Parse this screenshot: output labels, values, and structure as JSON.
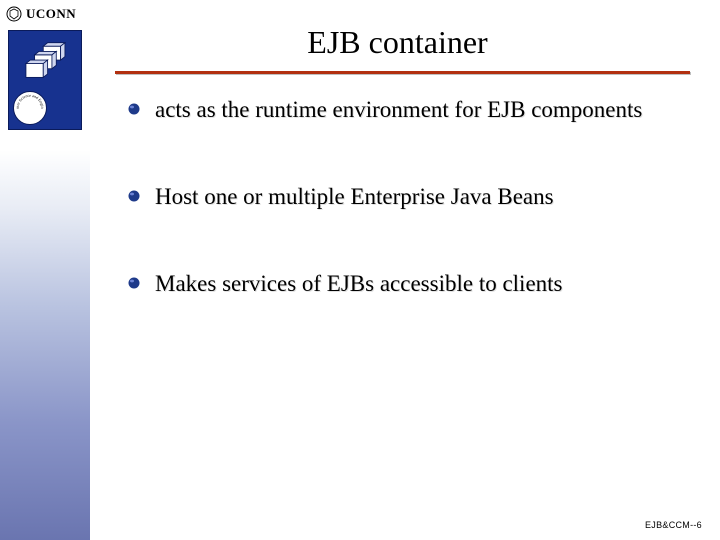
{
  "brand": {
    "uconn_label": "UCONN",
    "dept_circle_text": "Computer Science and Engineering"
  },
  "slide": {
    "title": "EJB container",
    "bullets": [
      "acts as the runtime environment for EJB components",
      "Host one or multiple Enterprise Java Beans",
      "Makes services of EJBs accessible to clients"
    ],
    "footer": "EJB&CCM--6"
  },
  "colors": {
    "rule": "#b23010",
    "bullet_fill": "#1e3a8a",
    "logo_bg": "#17328f"
  }
}
